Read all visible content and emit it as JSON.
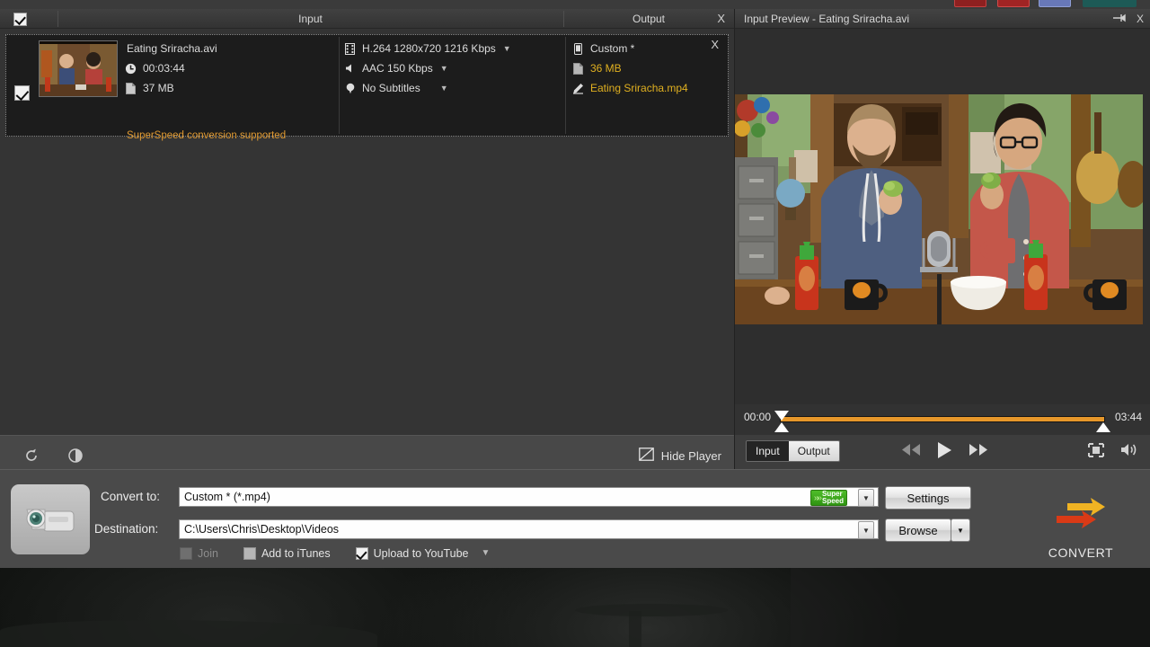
{
  "desktop": {
    "wallpaper_desc": "dark-landscape-wallpaper"
  },
  "top_strip": {
    "items": [
      "bookmark-red",
      "bookmark-red-2",
      "bookmark-blue",
      "bookmark-teal"
    ]
  },
  "list_header": {
    "input_label": "Input",
    "output_label": "Output",
    "close_label": "X",
    "select_all_checked": true
  },
  "file_row": {
    "checked": true,
    "filename": "Eating Sriracha.avi",
    "duration": "00:03:44",
    "size": "37 MB",
    "note": "SuperSpeed conversion supported",
    "video_codec": "H.264 1280x720 1216 Kbps",
    "audio_codec": "AAC 150 Kbps",
    "subtitles": "No Subtitles",
    "output_profile": "Custom *",
    "output_size": "36 MB",
    "output_filename": "Eating Sriracha.mp4",
    "remove_label": "X",
    "icons": {
      "clock": "clock-icon",
      "file": "file-icon",
      "film": "film-strip-icon",
      "speaker": "speaker-icon",
      "subtitle": "subtitle-balloon-icon",
      "device": "phone-device-icon",
      "pencil": "pencil-edit-icon"
    }
  },
  "left_toolbar": {
    "refresh_icon": "refresh-icon",
    "contrast_icon": "contrast-icon",
    "hide_player_label": "Hide Player",
    "hide_player_icon": "player-screen-icon"
  },
  "preview": {
    "title": "Input Preview - Eating Sriracha.avi",
    "pin_label": "⇥",
    "close_label": "X",
    "start_time": "00:00",
    "end_time": "03:44",
    "progress_percent": 100,
    "toggle": {
      "input_label": "Input",
      "output_label": "Output",
      "active": "Input"
    },
    "controls": {
      "rewind": "rewind-icon",
      "play": "play-icon",
      "forward": "fast-forward-icon",
      "fullscreen": "fullscreen-icon",
      "volume": "volume-icon"
    }
  },
  "bottom_bar": {
    "convert_to_label": "Convert to:",
    "convert_to_value": "Custom * (*.mp4)",
    "destination_label": "Destination:",
    "destination_value": "C:\\Users\\Chris\\Desktop\\Videos",
    "super_speed_label_line1": "Super",
    "super_speed_label_line2": "Speed",
    "settings_label": "Settings",
    "browse_label": "Browse",
    "convert_label": "CONVERT",
    "checkboxes": [
      {
        "label": "Join",
        "checked": false,
        "disabled": true
      },
      {
        "label": "Add to iTunes",
        "checked": false,
        "disabled": false
      },
      {
        "label": "Upload to YouTube",
        "checked": true,
        "disabled": false
      }
    ],
    "camcorder_icon": "camcorder-icon"
  },
  "colors": {
    "accent_orange": "#e6972a",
    "gold_text": "#e0b020",
    "superspeed_green": "#4fbd2a",
    "window_bg": "#3d3d3d",
    "list_bg": "#1c1c1c"
  }
}
